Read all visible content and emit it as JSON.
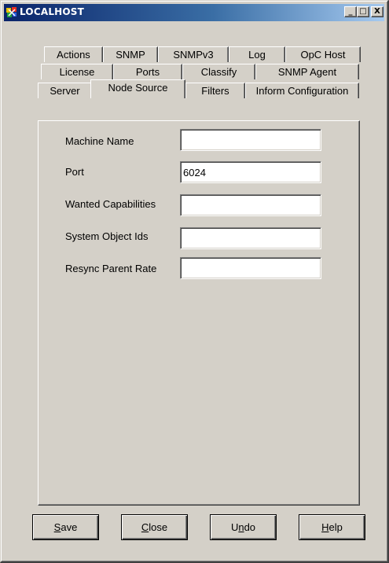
{
  "window": {
    "title": "LOCALHOST",
    "controls": {
      "minimize": "_",
      "maximize": "□",
      "close": "X"
    }
  },
  "tabs": {
    "row1": [
      {
        "label": "Actions"
      },
      {
        "label": "SNMP"
      },
      {
        "label": "SNMPv3"
      },
      {
        "label": "Log"
      },
      {
        "label": "OpC Host"
      }
    ],
    "row2": [
      {
        "label": "License"
      },
      {
        "label": "Ports"
      },
      {
        "label": "Classify"
      },
      {
        "label": "SNMP Agent"
      }
    ],
    "row3": [
      {
        "label": "Server"
      },
      {
        "label": "Node Source",
        "active": true
      },
      {
        "label": "Filters"
      },
      {
        "label": "Inform Configuration"
      }
    ]
  },
  "form": {
    "fields": [
      {
        "label": "Machine Name",
        "value": ""
      },
      {
        "label": "Port",
        "value": "6024"
      },
      {
        "label": "Wanted Capabilities",
        "value": ""
      },
      {
        "label": "System Object Ids",
        "value": ""
      },
      {
        "label": "Resync Parent Rate",
        "value": ""
      }
    ]
  },
  "buttons": {
    "save": {
      "accel": "S",
      "rest": "ave"
    },
    "close": {
      "accel": "C",
      "rest": "lose"
    },
    "undo": {
      "pre": "U",
      "accel": "n",
      "rest": "do"
    },
    "help": {
      "accel": "H",
      "rest": "elp"
    }
  },
  "colors": {
    "face": "#d4d0c8",
    "title_start": "#0a246a",
    "title_end": "#a6caf0"
  }
}
